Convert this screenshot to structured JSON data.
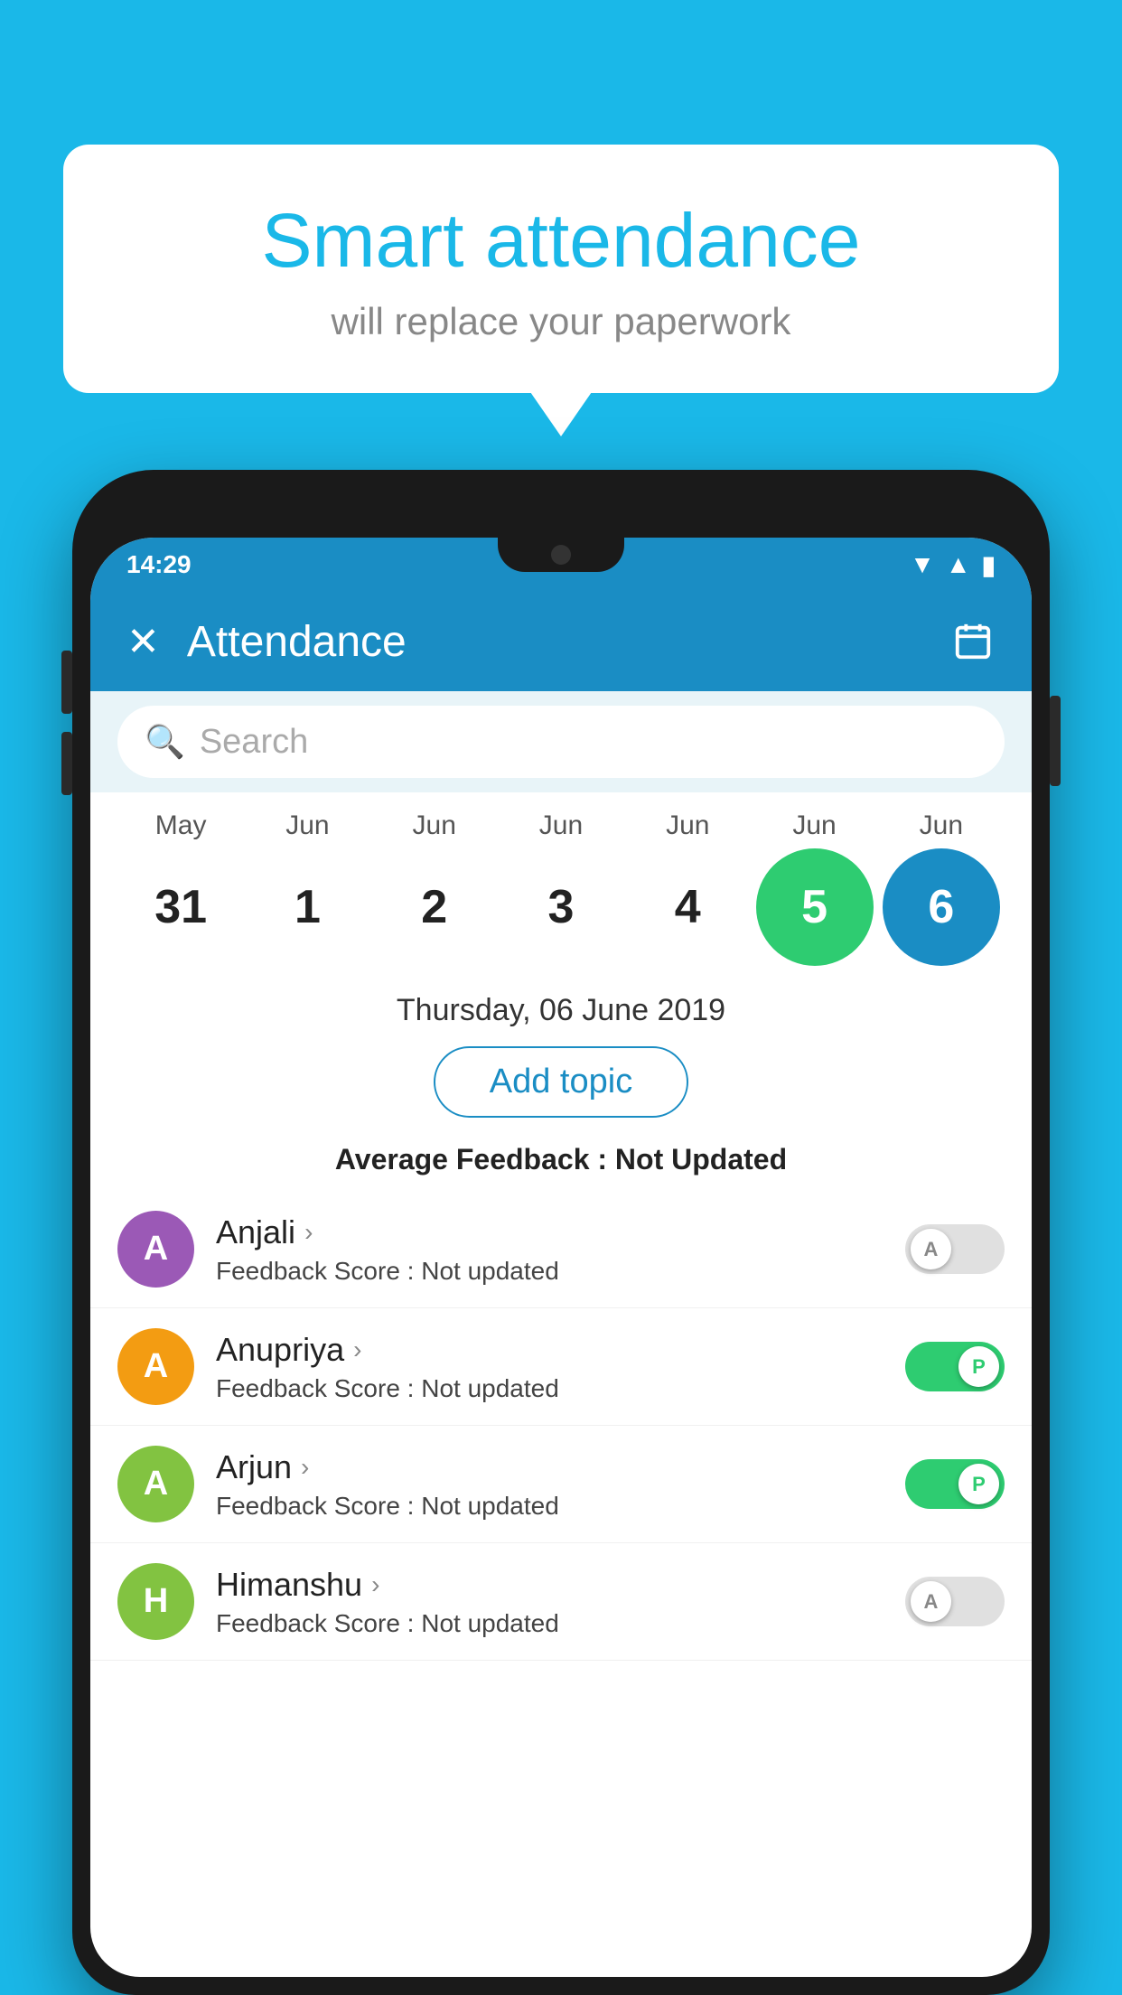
{
  "background_color": "#1ab8e8",
  "speech_bubble": {
    "title": "Smart attendance",
    "subtitle": "will replace your paperwork"
  },
  "status_bar": {
    "time": "14:29",
    "icons": [
      "wifi",
      "signal",
      "battery"
    ]
  },
  "app_bar": {
    "close_label": "✕",
    "title": "Attendance",
    "calendar_icon": "calendar"
  },
  "search": {
    "placeholder": "Search"
  },
  "calendar": {
    "months": [
      "May",
      "Jun",
      "Jun",
      "Jun",
      "Jun",
      "Jun",
      "Jun"
    ],
    "dates": [
      "31",
      "1",
      "2",
      "3",
      "4",
      "5",
      "6"
    ],
    "today_index": 5,
    "selected_index": 6
  },
  "selected_date": "Thursday, 06 June 2019",
  "add_topic_label": "Add topic",
  "average_feedback": {
    "label": "Average Feedback :",
    "value": "Not Updated"
  },
  "students": [
    {
      "name": "Anjali",
      "avatar_letter": "A",
      "avatar_color": "#9b59b6",
      "feedback_label": "Feedback Score :",
      "feedback_value": "Not updated",
      "toggle_state": "off",
      "toggle_label": "A"
    },
    {
      "name": "Anupriya",
      "avatar_letter": "A",
      "avatar_color": "#f39c12",
      "feedback_label": "Feedback Score :",
      "feedback_value": "Not updated",
      "toggle_state": "on",
      "toggle_label": "P"
    },
    {
      "name": "Arjun",
      "avatar_letter": "A",
      "avatar_color": "#82c341",
      "feedback_label": "Feedback Score :",
      "feedback_value": "Not updated",
      "toggle_state": "on",
      "toggle_label": "P"
    },
    {
      "name": "Himanshu",
      "avatar_letter": "H",
      "avatar_color": "#82c341",
      "feedback_label": "Feedback Score :",
      "feedback_value": "Not updated",
      "toggle_state": "off",
      "toggle_label": "A"
    }
  ]
}
